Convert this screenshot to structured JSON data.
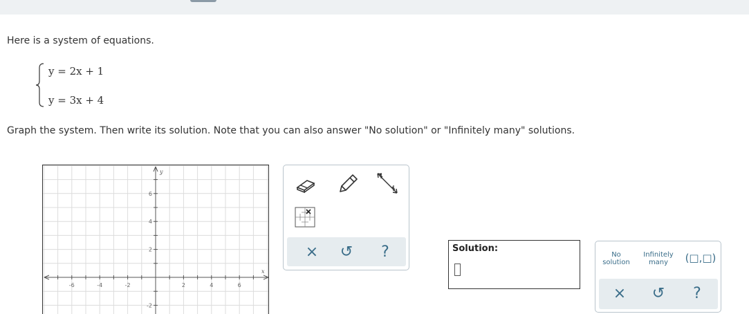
{
  "intro_text": "Here is a system of equations.",
  "equations": [
    "y = 2x + 1",
    "y = 3x + 4"
  ],
  "instructions": "Graph the system. Then write its solution. Note that you can also answer \"No solution\" or \"Infinitely many\" solutions.",
  "graph": {
    "x_axis_label": "x",
    "y_axis_label": "y",
    "x_tick_labels": [
      "-6",
      "-4",
      "-2",
      "2",
      "4",
      "6"
    ],
    "y_tick_labels": [
      "6",
      "4",
      "2",
      "-2"
    ],
    "x_range": [
      -8,
      8
    ],
    "y_range": [
      -2.5,
      8
    ]
  },
  "tools": {
    "eraser": "eraser-icon",
    "pencil": "pencil-icon",
    "line": "line-tool-icon",
    "points": "point-grid-icon",
    "clear": "×",
    "undo": "↺",
    "help": "?"
  },
  "solution": {
    "label": "Solution:"
  },
  "answer_options": {
    "no_solution": "No solution",
    "infinitely_many": "Infinitely many",
    "ordered_pair": "(□,□)",
    "clear": "×",
    "undo": "↺",
    "help": "?"
  },
  "colors": {
    "accent": "#3a6d89",
    "panel_bg": "#e6ecef",
    "grid": "#dcdcdc"
  }
}
